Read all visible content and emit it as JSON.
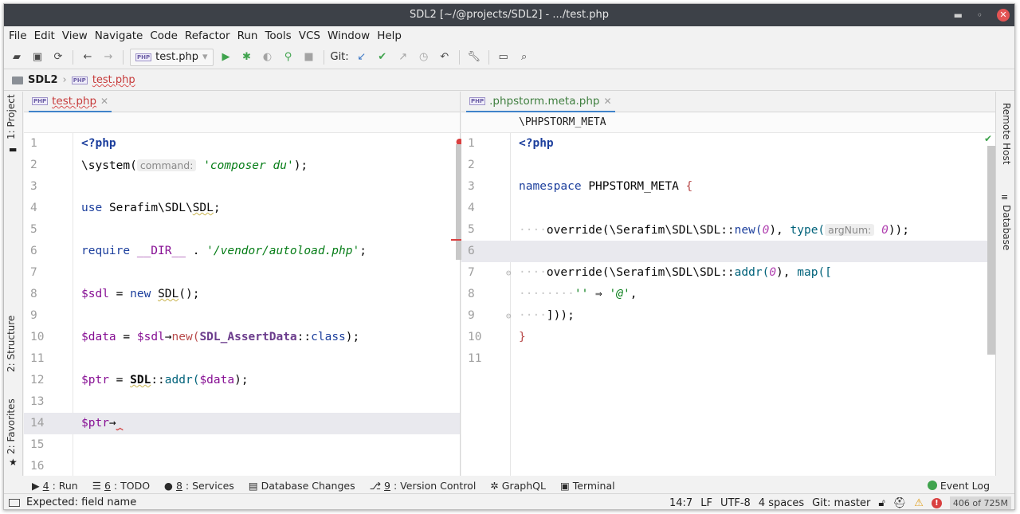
{
  "window": {
    "title": "SDL2 [~/@projects/SDL2] - .../test.php"
  },
  "menu": [
    "File",
    "Edit",
    "View",
    "Navigate",
    "Code",
    "Refactor",
    "Run",
    "Tools",
    "VCS",
    "Window",
    "Help"
  ],
  "toolbar": {
    "run_config": "test.php",
    "git_label": "Git:"
  },
  "breadcrumb": {
    "root": "SDL2",
    "file": "test.php"
  },
  "left_editor": {
    "tab": "test.php",
    "lines": [
      "1",
      "2",
      "3",
      "4",
      "5",
      "6",
      "7",
      "8",
      "9",
      "10",
      "11",
      "12",
      "13",
      "14",
      "15",
      "16"
    ]
  },
  "right_editor": {
    "tab": ".phpstorm.meta.php",
    "crumb": "\\PHPSTORM_META",
    "lines": [
      "1",
      "2",
      "3",
      "4",
      "5",
      "6",
      "7",
      "8",
      "9",
      "10",
      "11"
    ]
  },
  "code": {
    "php_open": "<?php",
    "system_fn": "\\system(",
    "hint_command": "command:",
    "composer_str": "'composer du'",
    "close_semicolon": ");",
    "use_kw": "use",
    "use_path_1": "Serafim\\SDL\\",
    "use_path_2": "SDL",
    "semicolon": ";",
    "require_kw": "require",
    "dir_const": "__DIR__",
    "dot_op": ".",
    "autoload_str": "'/vendor/autoload.php'",
    "sdl_var": "$sdl",
    "eq": "=",
    "new_kw": "new",
    "sdl_class": "SDL",
    "call_parens": "();",
    "data_var": "$data",
    "arrow": "→",
    "new_method": "new(",
    "assert_class": "SDL_AssertData",
    "double_colon": "::",
    "class_kw": "class",
    "ptr_var": "$ptr",
    "addr_method": "addr(",
    "close_paren": ");",
    "caret_err": "_",
    "namespace_kw": "namespace",
    "namespace_name": "PHPSTORM_META",
    "brace_open": "{",
    "brace_close": "}",
    "override_fn": "override(",
    "meta_sdl_path": "\\Serafim\\SDL\\SDL",
    "new_call": "new(",
    "zero": "0",
    "type_fn": "type(",
    "hint_argnum": "argNum:",
    "close_double": "));",
    "addr_call": "addr(",
    "map_fn": "map([",
    "empty_str": "''",
    "fat_arrow": "⇒",
    "at_str": "'@'",
    "comma": ",",
    "close_map": "]));",
    "close_one_comma": "),"
  },
  "left_tool_tabs": [
    "1: Project",
    "2: Structure",
    "2: Favorites"
  ],
  "right_tool_tabs": [
    "Remote Host",
    "Database"
  ],
  "tool_windows": [
    {
      "num": "4",
      "label": ": Run"
    },
    {
      "num": "6",
      "label": ": TODO"
    },
    {
      "num": "8",
      "label": ": Services"
    },
    {
      "num": "",
      "label": "Database Changes"
    },
    {
      "num": "9",
      "label": ": Version Control"
    },
    {
      "num": "",
      "label": "GraphQL"
    },
    {
      "num": "",
      "label": "Terminal"
    }
  ],
  "event_log": "Event Log",
  "status": {
    "message": "Expected: field name",
    "position": "14:7",
    "line_sep": "LF",
    "encoding": "UTF-8",
    "indent": "4 spaces",
    "git": "Git: master",
    "memory": "406 of 725M"
  }
}
